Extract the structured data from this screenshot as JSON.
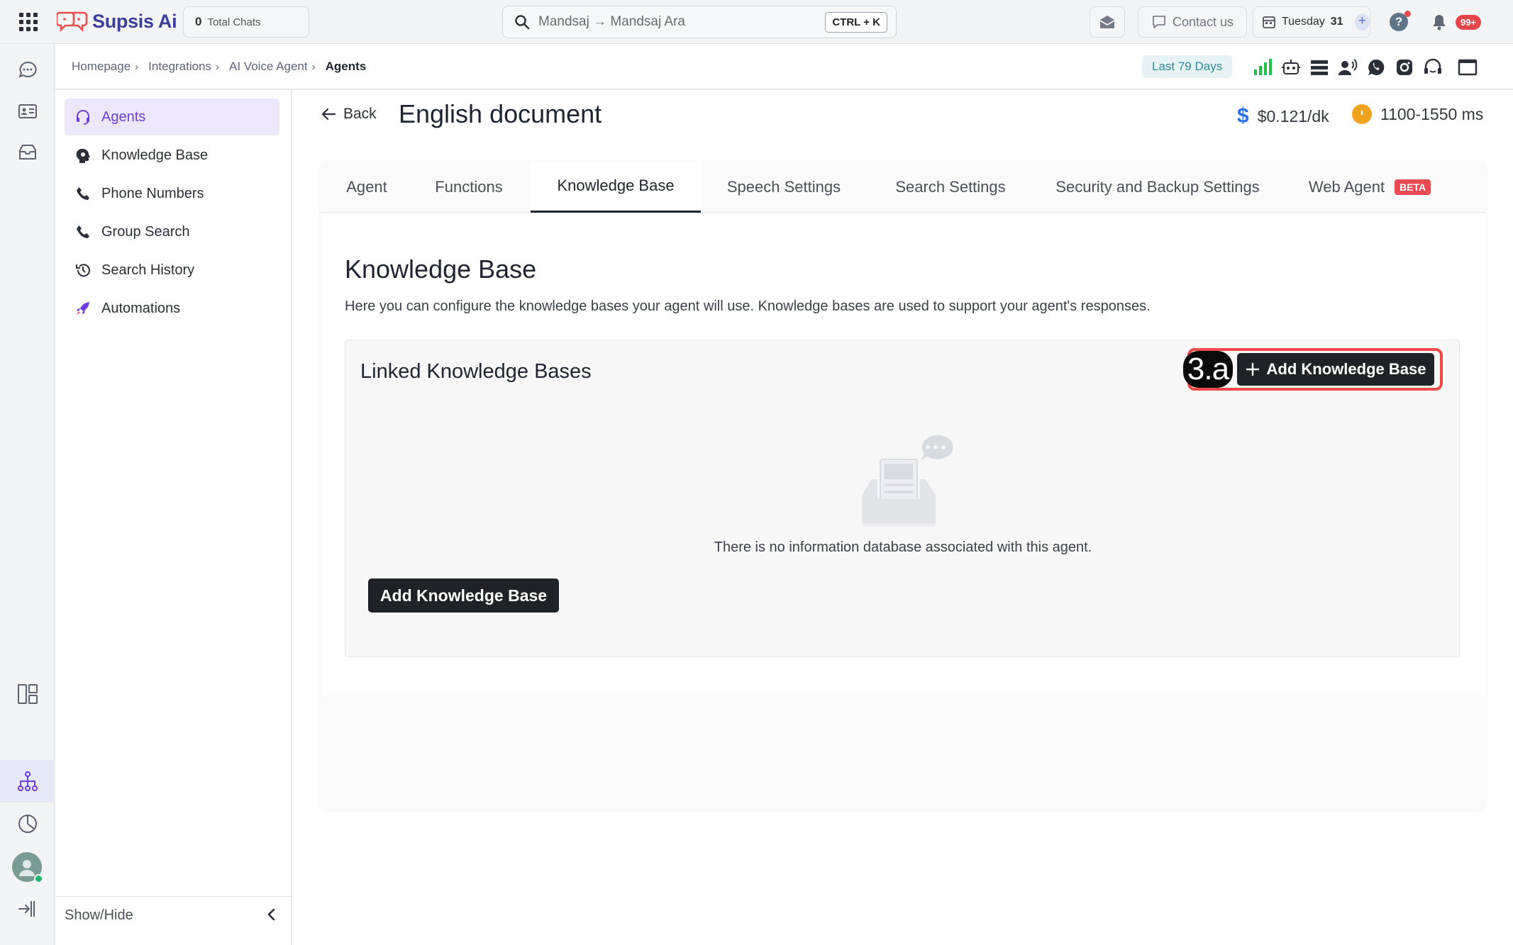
{
  "app": {
    "name": "Supsis Ai",
    "total_chats": {
      "count": "0",
      "label": "Total Chats"
    }
  },
  "search": {
    "placeholder": "Mandsaj → Mandsaj Ara",
    "shortcut": "CTRL + K"
  },
  "topbar": {
    "contact_label": "Contact us",
    "date_day": "Tuesday",
    "date_num": "31",
    "help_label": "?",
    "notifications_badge": "99+"
  },
  "breadcrumb": {
    "items": [
      "Homepage",
      "Integrations",
      "AI Voice Agent"
    ],
    "current": "Agents"
  },
  "date_range": "Last 79 Days",
  "sidebar": {
    "items": [
      {
        "label": "Agents",
        "icon": "headset-icon",
        "active": true
      },
      {
        "label": "Knowledge Base",
        "icon": "brain-head-icon"
      },
      {
        "label": "Phone Numbers",
        "icon": "phone-icon"
      },
      {
        "label": "Group Search",
        "icon": "phone-icon"
      },
      {
        "label": "Search History",
        "icon": "history-icon"
      },
      {
        "label": "Automations",
        "icon": "rocket-icon"
      }
    ],
    "show_hide": "Show/Hide"
  },
  "header": {
    "back_label": "Back",
    "title": "English document",
    "price": "$0.121/dk",
    "latency": "1100-1550 ms"
  },
  "tabs": [
    {
      "label": "Agent"
    },
    {
      "label": "Functions"
    },
    {
      "label": "Knowledge Base",
      "active": true
    },
    {
      "label": "Speech Settings"
    },
    {
      "label": "Search Settings"
    },
    {
      "label": "Security and Backup Settings"
    },
    {
      "label": "Web Agent",
      "badge": "BETA"
    }
  ],
  "knowledge": {
    "title": "Knowledge Base",
    "description": "Here you can configure the knowledge bases your agent will use. Knowledge bases are used to support your agent's responses.",
    "linked_title": "Linked Knowledge Bases",
    "annotation": "3.a",
    "add_button": "Add Knowledge Base",
    "empty_text": "There is no information database associated with this agent.",
    "add_button_bottom": "Add Knowledge Base"
  },
  "colors": {
    "accent": "#6b3fd8",
    "annotation_red": "#ef4a4a",
    "badge_red": "#e7454c",
    "dark_button": "#1f2328"
  }
}
